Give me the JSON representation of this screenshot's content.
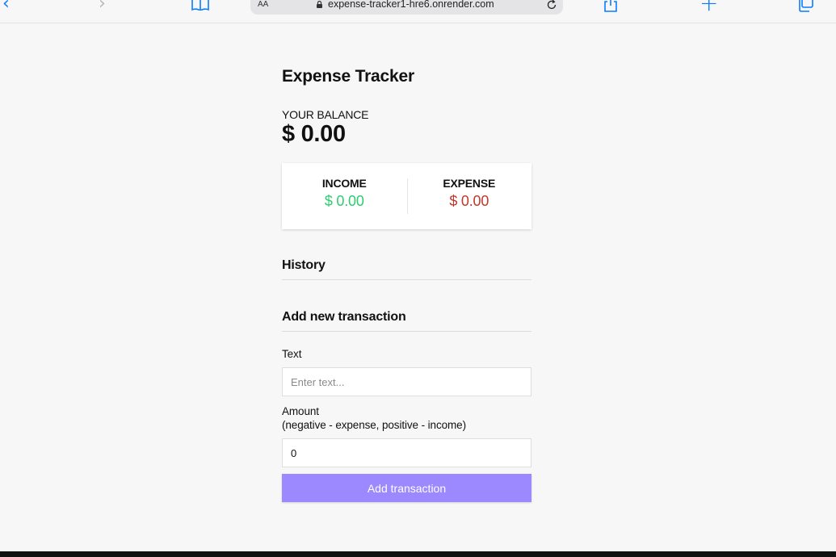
{
  "browser": {
    "text_size_label": "AA",
    "url": "expense-tracker1-hre6.onrender.com",
    "icons": {
      "back": "chevron-left-icon",
      "forward": "chevron-right-icon",
      "bookmarks": "book-icon",
      "lock": "lock-icon",
      "reload": "reload-icon",
      "share": "share-icon",
      "new_tab": "plus-icon",
      "tabs": "tabs-icon"
    },
    "accent_color": "#0a7cff"
  },
  "app": {
    "title": "Expense Tracker",
    "balance": {
      "label": "YOUR BALANCE",
      "value": "$ 0.00"
    },
    "income": {
      "label": "INCOME",
      "value": "$ 0.00",
      "color": "#2ecc71"
    },
    "expense": {
      "label": "EXPENSE",
      "value": "$ 0.00",
      "color": "#c0392b"
    },
    "history": {
      "heading": "History"
    },
    "add_form": {
      "heading": "Add new transaction",
      "text_label": "Text",
      "text_placeholder": "Enter text...",
      "text_value": "",
      "amount_label": "Amount",
      "amount_hint": "(negative - expense, positive - income)",
      "amount_value": "0",
      "submit_label": "Add transaction",
      "button_color": "#9c88ff"
    }
  }
}
